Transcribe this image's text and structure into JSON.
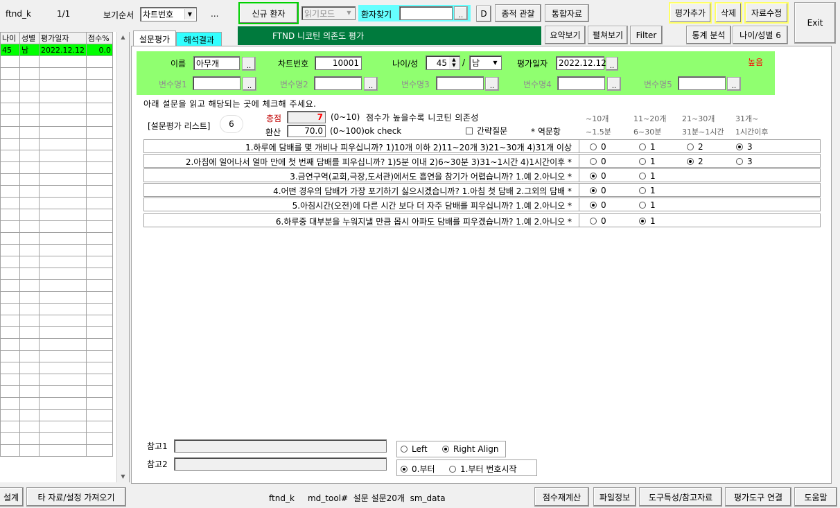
{
  "header": {
    "app_id": "ftnd_k",
    "record_count": "1/1",
    "sort_label": "보기순서",
    "sort_value": "차트번호",
    "more": "...",
    "new_patient": "신규 환자",
    "read_mode": "읽기모드",
    "find_patient": "환자찾기",
    "find_btn": "..",
    "d_btn": "D",
    "followup": "종적 관찰",
    "integrated": "통합자료",
    "add_eval": "평가추가",
    "delete": "삭제",
    "edit_data": "자료수정",
    "exit": "Exit",
    "test_title": "FTND 니코틴 의존도 평가",
    "summary": "요약보기",
    "expand": "펼쳐보기",
    "filter": "Filter",
    "stats": "통계 분석",
    "age_sex": "나이/성별 6"
  },
  "grid": {
    "columns": [
      "나이",
      "성별",
      "평가일자",
      "점수%"
    ],
    "rows": [
      [
        "45",
        "남",
        "2022.12.12",
        "0.0"
      ]
    ]
  },
  "tabs": [
    "설문평가",
    "해석결과"
  ],
  "patient": {
    "name_label": "이름",
    "name_value": "아무개",
    "chart_label": "차트번호",
    "chart_value": "10001",
    "age_sex_label": "나이/성",
    "age_value": "45",
    "sex_value": "남",
    "date_label": "평가일자",
    "date_value": "2022.12.12",
    "level": "높음",
    "var1": "변수명1",
    "var2": "변수명2",
    "var3": "변수명3",
    "var4": "변수명4",
    "var5": "변수명5",
    "dots": ".."
  },
  "instructions": "아래 설문을 읽고 해당되는 곳에 체크해 주세요.",
  "list_label": "[설문평가 리스트]",
  "list_count": "6",
  "score": {
    "total_label": "총점",
    "total_value": "7",
    "total_range": "(0~10)",
    "note": "점수가 높을수록 니코틴 의존성",
    "conv_label": "환산",
    "conv_value": "70.0",
    "conv_range": "(0~100)",
    "ok_check": "ok check",
    "brief_label": "간략질문",
    "reverse_label": "* 역문항"
  },
  "col_heads": [
    [
      "~10개",
      "~1.5분"
    ],
    [
      "11~20개",
      "6~30분"
    ],
    [
      "21~30개",
      "31분~1시간"
    ],
    [
      "31개~",
      "1시간이후"
    ]
  ],
  "questions": [
    {
      "text": "1.하루에 담배를 몇 개비나 피우십니까? 1)10개 이하  2)11~20개  3)21~30개  4)31개 이상",
      "opts": [
        "0",
        "1",
        "2",
        "3"
      ],
      "sel": 3
    },
    {
      "text": "2.아침에 일어나서 얼마 만에 첫 번째 담배를 피우십니까? 1)5분 이내  2)6~30분  3)31~1시간  4)1시간이후 *",
      "opts": [
        "0",
        "1",
        "2",
        "3"
      ],
      "sel": 2
    },
    {
      "text": "3.금연구역(교회,극장,도서관)에서도 흡연을 참기가 어렵습니까? 1.예  2.아니오 *",
      "opts": [
        "0",
        "1"
      ],
      "sel": 0
    },
    {
      "text": "4.어떤 경우의 담배가 가장 포기하기 싫으시겠습니까?  1.아침 첫 담배  2.그외의 담배 *",
      "opts": [
        "0",
        "1"
      ],
      "sel": 0
    },
    {
      "text": "5.아침시간(오전)에 다른 시간 보다 더 자주 담배를 피우십니까? 1.예  2.아니오 *",
      "opts": [
        "0",
        "1"
      ],
      "sel": 0
    },
    {
      "text": "6.하루중 대부분을 누워지낼 만큼 몹시 아파도 담배를 피우겠습니까? 1.예  2.아니오 *",
      "opts": [
        "0",
        "1"
      ],
      "sel": 1
    }
  ],
  "notes": {
    "ref1": "참고1",
    "ref2": "참고2",
    "left": "Left",
    "right_align": "Right Align",
    "from0": "0.부터",
    "from1": "1.부터 번호시작"
  },
  "footer": {
    "design": "설계",
    "import": "타 자료/설정 가져오기",
    "status": "ftnd_k     md_tool#  설문 설문20개  sm_data",
    "recalc": "점수재계산",
    "file_info": "파일정보",
    "tool_info": "도구특성/참고자료",
    "link_tool": "평가도구 연결",
    "help": "도움말"
  }
}
